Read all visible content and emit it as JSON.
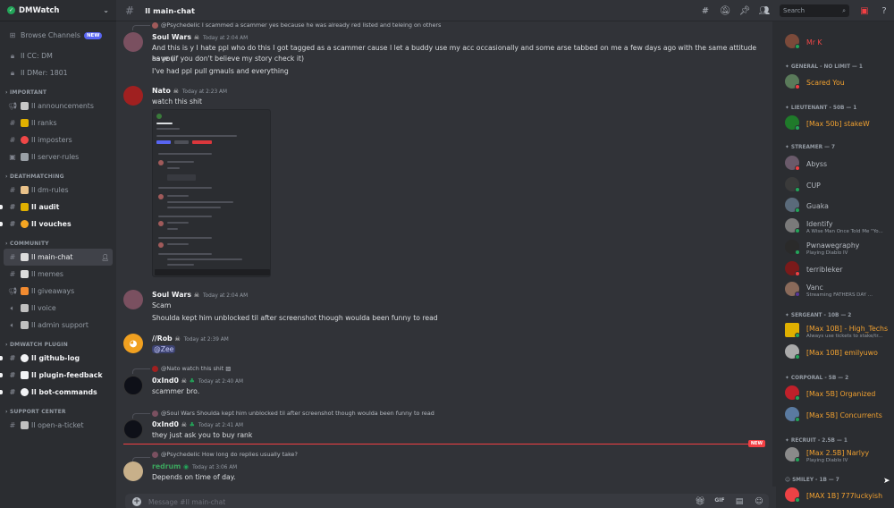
{
  "server": {
    "name": "DMWatch"
  },
  "sidebar": {
    "browse": {
      "label": "Browse Channels",
      "badge": "NEW"
    },
    "top_channels": [
      {
        "label": "II CC: DM"
      },
      {
        "label": "II DMer: 1801"
      }
    ],
    "categories": [
      {
        "name": "IMPORTANT",
        "channels": [
          {
            "label": "II announcements",
            "emoji_color": "#c7c7c7"
          },
          {
            "label": "II ranks",
            "emoji_color": "#e0b000"
          },
          {
            "label": "II imposters",
            "emoji_color": "#f04747"
          },
          {
            "label": "II server-rules",
            "emoji_color": "#9aa0a6"
          }
        ]
      },
      {
        "name": "DEATHMATCHING",
        "channels": [
          {
            "label": "II dm-rules",
            "emoji_color": "#e9c28a"
          },
          {
            "label": "II audit",
            "emoji_color": "#e0b000",
            "bold": true
          },
          {
            "label": "II vouches",
            "emoji_color": "#f5a623",
            "bold": true
          }
        ]
      },
      {
        "name": "COMMUNITY",
        "channels": [
          {
            "label": "II main-chat",
            "emoji_color": "#dcdcdc",
            "active": true
          },
          {
            "label": "II memes",
            "emoji_color": "#dcdcdc"
          },
          {
            "label": "II giveaways",
            "emoji_color": "#f28b30"
          },
          {
            "label": "II voice",
            "emoji_color": "#c0c0c0"
          },
          {
            "label": "II admin support",
            "emoji_color": "#c0c0c0"
          }
        ]
      },
      {
        "name": "DMWATCH PLUGIN",
        "channels": [
          {
            "label": "II github-log",
            "emoji_color": "#f2f3f5",
            "bold": true
          },
          {
            "label": "II plugin-feedback",
            "emoji_color": "#f2f3f5",
            "bold": true
          },
          {
            "label": "II bot-commands",
            "emoji_color": "#f2f3f5",
            "bold": true
          }
        ]
      },
      {
        "name": "SUPPORT CENTER",
        "channels": [
          {
            "label": "II open-a-ticket",
            "emoji_color": "#c0c0c0"
          }
        ]
      }
    ]
  },
  "header": {
    "channel": "II main-chat",
    "search_placeholder": "Search"
  },
  "messages": {
    "m0_reply": "@Psychedelic I scammed a scammer yes because he was already red listed and teleing on others",
    "m1": {
      "user": "Soul Wars",
      "time": "Today at 2:04 AM",
      "line1": "And this is y I hate ppl who do this I got tagged as a scammer cause I let a buddy use my acc occasionally and some arse tabbed on me a few days ago with the same attitude as you",
      "line2": "have (if you don't believe my story check it)",
      "line3": "I've had ppl pull gmauls and everything"
    },
    "m2": {
      "user": "Nato",
      "time": "Today at 2:23 AM",
      "text": "watch this shit"
    },
    "m3": {
      "user": "Soul Wars",
      "time": "Today at 2:04 AM",
      "line1": "Scam",
      "line2": "Shoulda kept him unblocked til after screenshot though woulda been funny to read"
    },
    "m4": {
      "user": "//Rob",
      "time": "Today at 2:39 AM",
      "mention": "@Zee"
    },
    "m5": {
      "reply": "@Nato watch this shit",
      "user": "0xInd0",
      "time": "Today at 2:40 AM",
      "text": "scammer bro."
    },
    "m6": {
      "reply": "@Soul Wars Shoulda kept him unblocked til after screenshot though woulda been funny to read",
      "user": "0xInd0",
      "time": "Today at 2:41 AM",
      "text": "they just ask you to buy rank"
    },
    "new_label": "NEW",
    "m7": {
      "reply": "@Psychedelic How long do replies usually take?",
      "user": "redrum",
      "time": "Today at 3:06 AM",
      "text": "Depends on time of day."
    }
  },
  "composer": {
    "placeholder": "Message #II main-chat"
  },
  "members": {
    "groups": [
      {
        "title": "",
        "members": [
          {
            "name": "Mr K",
            "color": "#f04747",
            "avatar": "#7b4a3a"
          }
        ]
      },
      {
        "title": "GENERAL - NO LIMIT — 1",
        "members": [
          {
            "name": "Scared You",
            "color": "#f0a030",
            "avatar": "#5a7a5a"
          }
        ]
      },
      {
        "title": "LIEUTENANT - 50B — 1",
        "members": [
          {
            "name": "[Max 50b] stakeW",
            "color": "#f0a030",
            "avatar": "#1f7a2a"
          }
        ]
      },
      {
        "title": "STREAMER — 7",
        "members": [
          {
            "name": "Abyss",
            "color": "#b5bac1",
            "avatar": "#6a5a6a"
          },
          {
            "name": "CUP",
            "color": "#b5bac1",
            "avatar": "#3a3a3a"
          },
          {
            "name": "Guaka",
            "color": "#b5bac1",
            "avatar": "#5a6a7a"
          },
          {
            "name": "Identify",
            "color": "#b5bac1",
            "avatar": "#7a7a7a",
            "status": "A Wise Man Once Told Me \"Yo..."
          },
          {
            "name": "Pwnawegraphy",
            "color": "#b5bac1",
            "avatar": "#2a2a2a",
            "status": "Playing Diablo IV"
          },
          {
            "name": "terribleker",
            "color": "#b5bac1",
            "avatar": "#7a1a1a"
          },
          {
            "name": "Vanc",
            "color": "#b5bac1",
            "avatar": "#8a6a5a",
            "status": "Streaming FATHERS DAY ..."
          }
        ]
      },
      {
        "title": "SERGEANT - 10B — 2",
        "members": [
          {
            "name": "[Max 10B] - High_Techs",
            "color": "#f0a030",
            "avatar": "#e0b000",
            "status": "Always use tickets to stake/tr..."
          },
          {
            "name": "[Max 10B] emilyuwo",
            "color": "#f0a030",
            "avatar": "#aaaaaa"
          }
        ]
      },
      {
        "title": "CORPORAL - 5B — 2",
        "members": [
          {
            "name": "[Max 5B] Organized",
            "color": "#f0a030",
            "avatar": "#c0202a"
          },
          {
            "name": "[Max 5B] Concurrents",
            "color": "#f0a030",
            "avatar": "#5a7aa0"
          }
        ]
      },
      {
        "title": "RECRUIT - 2.5B — 1",
        "members": [
          {
            "name": "[Max 2.5B] Narlyy",
            "color": "#f0a030",
            "avatar": "#8a8a8a",
            "status": "Playing Diablo IV"
          }
        ]
      },
      {
        "title": "SMILEY - 1B — 7",
        "members": [
          {
            "name": "[MAX 1B] 777luckyish",
            "color": "#f0a030",
            "avatar": "#ed4245"
          }
        ]
      }
    ]
  }
}
